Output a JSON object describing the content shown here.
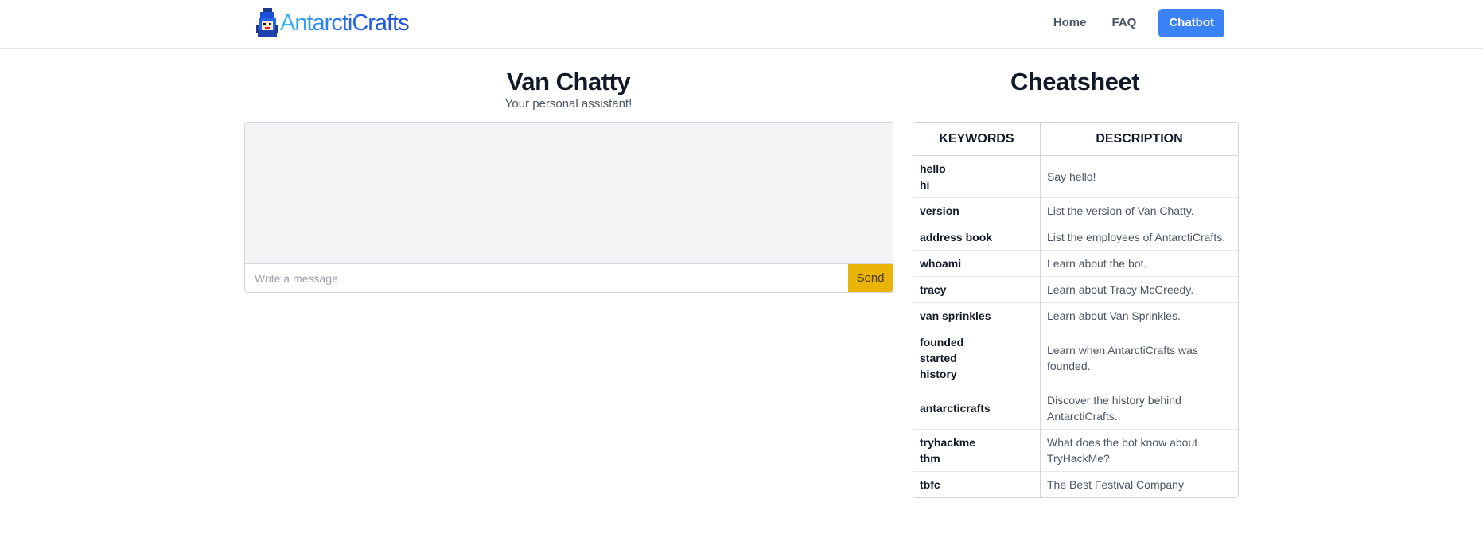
{
  "brand": {
    "name": "AntarctiCrafts"
  },
  "nav": {
    "items": [
      {
        "label": "Home"
      },
      {
        "label": "FAQ"
      },
      {
        "label": "Chatbot",
        "active": true
      }
    ]
  },
  "chat": {
    "title": "Van Chatty",
    "subtitle": "Your personal assistant!",
    "input_placeholder": "Write a message",
    "send_label": "Send"
  },
  "cheatsheet": {
    "title": "Cheatsheet",
    "columns": [
      "KEYWORDS",
      "DESCRIPTION"
    ],
    "rows": [
      {
        "keywords": [
          "hello",
          "hi"
        ],
        "description": "Say hello!"
      },
      {
        "keywords": [
          "version"
        ],
        "description": "List the version of Van Chatty."
      },
      {
        "keywords": [
          "address book"
        ],
        "description": "List the employees of AntarctiCrafts."
      },
      {
        "keywords": [
          "whoami"
        ],
        "description": "Learn about the bot."
      },
      {
        "keywords": [
          "tracy"
        ],
        "description": "Learn about Tracy McGreedy."
      },
      {
        "keywords": [
          "van sprinkles"
        ],
        "description": "Learn about Van Sprinkles."
      },
      {
        "keywords": [
          "founded",
          "started",
          "history"
        ],
        "description": "Learn when AntarctiCrafts was founded."
      },
      {
        "keywords": [
          "antarcticrafts"
        ],
        "description": "Discover the history behind AntarctiCrafts."
      },
      {
        "keywords": [
          "tryhackme",
          "thm"
        ],
        "description": "What does the bot know about TryHackMe?"
      },
      {
        "keywords": [
          "tbfc"
        ],
        "description": "The Best Festival Company"
      }
    ]
  },
  "colors": {
    "accent": "#3b82f6",
    "send_button": "#eab308",
    "chat_log_bg": "#f3f4f6"
  }
}
